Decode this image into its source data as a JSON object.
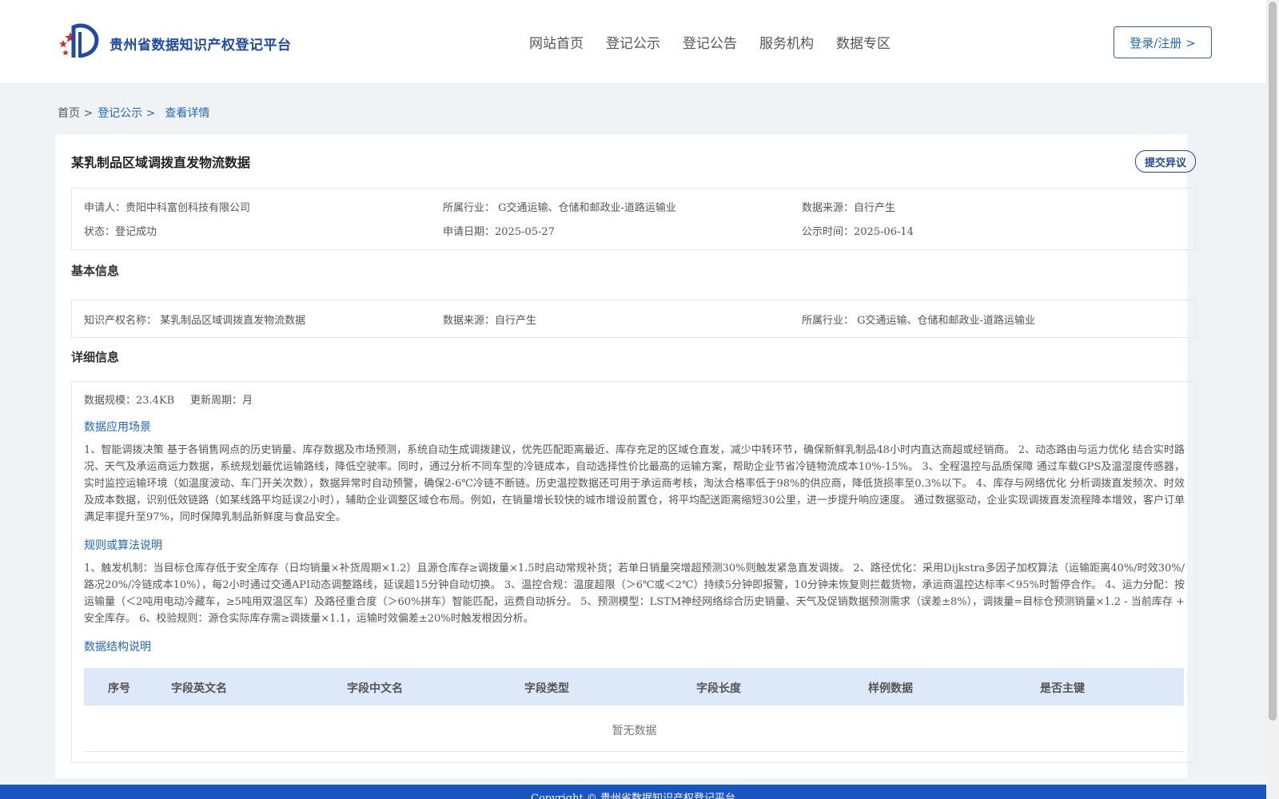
{
  "header": {
    "site_name": "贵州省数据知识产权登记平台",
    "nav": [
      "网站首页",
      "登记公示",
      "登记公告",
      "服务机构",
      "数据专区"
    ],
    "login_label": "登录/注册 >"
  },
  "breadcrumb": {
    "home": "首页 >",
    "list": "登记公示 >",
    "current": "查看详情"
  },
  "record": {
    "title": "某乳制品区域调拨直发物流数据",
    "objection_label": "提交异议",
    "applicant": "申请人：贵阳中科富创科技有限公司",
    "industry": "所属行业： G交通运输、仓储和邮政业-道路运输业",
    "source": "数据来源：自行产生",
    "status": "状态：登记成功",
    "apply_date": "申请日期：2025-05-27",
    "publish_date": "公示时间：2025-06-14"
  },
  "basic": {
    "heading": "基本信息",
    "ip_name": "知识产权名称： 某乳制品区域调拨直发物流数据",
    "source": "数据来源：自行产生",
    "industry": "所属行业： G交通运输、仓储和邮政业-道路运输业"
  },
  "detail": {
    "heading": "详细信息",
    "size": "数据规模：23.4KB",
    "cycle": "更新周期：月",
    "scenario_heading": "数据应用场景",
    "scenario_text": "1、智能调拨决策 基于各销售网点的历史销量、库存数据及市场预测，系统自动生成调拨建议，优先匹配距离最近、库存充足的区域仓直发，减少中转环节，确保新鲜乳制品48小时内直达商超或经销商。 2、动态路由与运力优化 结合实时路况、天气及承运商运力数据，系统规划最优运输路线，降低空驶率。同时，通过分析不同车型的冷链成本，自动选择性价比最高的运输方案，帮助企业节省冷链物流成本10%-15%。 3、全程温控与品质保障 通过车载GPS及温湿度传感器，实时监控运输环境（如温度波动、车门开关次数），数据异常时自动预警，确保2-6℃冷链不断链。历史温控数据还可用于承运商考核，淘汰合格率低于98%的供应商，降低货损率至0.3%以下。 4、库存与网络优化 分析调拨直发频次、时效及成本数据，识别低效链路（如某线路平均延误2小时），辅助企业调整区域仓布局。例如，在销量增长较快的城市增设前置仓，将平均配送距离缩短30公里，进一步提升响应速度。 通过数据驱动，企业实现调拨直发流程降本增效，客户订单满足率提升至97%，同时保障乳制品新鲜度与食品安全。",
    "rule_heading": "规则或算法说明",
    "rule_text": "1、触发机制：当目标仓库存低于安全库存（日均销量×补货周期×1.2）且源仓库存≥调拨量×1.5时启动常规补货；若单日销量突增超预测30%则触发紧急直发调拨。 2、路径优化：采用Dijkstra多因子加权算法（运输距离40%/时效30%/路况20%/冷链成本10%），每2小时通过交通API动态调整路线，延误超15分钟自动切换。 3、温控合规：温度超限（＞6℃或＜2℃）持续5分钟即报警，10分钟未恢复则拦截货物，承运商温控达标率＜95%时暂停合作。 4、运力分配：按运输量（＜2吨用电动冷藏车，≥5吨用双温区车）及路径重合度（＞60%拼车）智能匹配，运费自动拆分。 5、预测模型：LSTM神经网络综合历史销量、天气及促销数据预测需求（误差±8%），调拨量=目标仓预测销量×1.2 - 当前库存 + 安全库存。 6、校验规则：源仓实际库存需≥调拨量×1.1，运输时效偏差±20%时触发根因分析。",
    "structure_heading": "数据结构说明",
    "columns": [
      "序号",
      "字段英文名",
      "字段中文名",
      "字段类型",
      "字段长度",
      "样例数据",
      "是否主键"
    ],
    "empty_text": "暂无数据"
  },
  "footer": {
    "text": "Copyright © 贵州省数据知识产权登记平台"
  },
  "colors": {
    "brand": "#1f4aa8",
    "link": "#1f66c8",
    "footer": "#1a56c2",
    "table_head": "#dde9f8"
  }
}
